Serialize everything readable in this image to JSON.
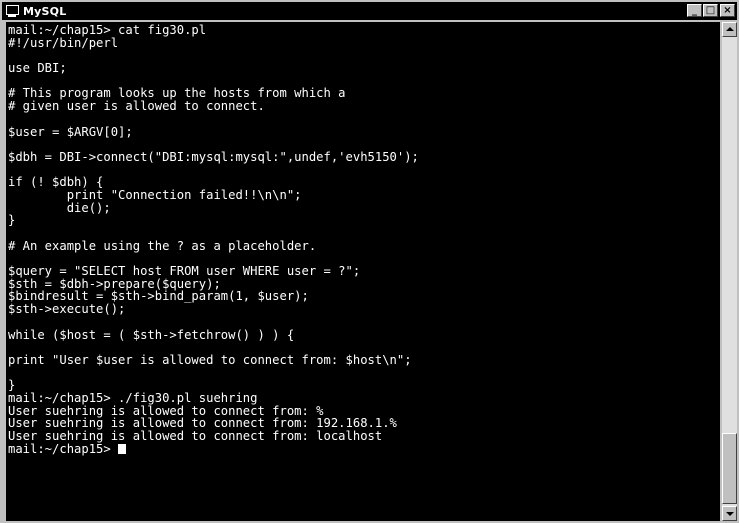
{
  "window": {
    "title": "MySQL",
    "icon": "console-icon",
    "controls": {
      "minimize": "_",
      "maximize": "□",
      "close": "×"
    }
  },
  "console": {
    "lines": [
      "mail:~/chap15> cat fig30.pl",
      "#!/usr/bin/perl",
      "",
      "use DBI;",
      "",
      "# This program looks up the hosts from which a",
      "# given user is allowed to connect.",
      "",
      "$user = $ARGV[0];",
      "",
      "$dbh = DBI->connect(\"DBI:mysql:mysql:\",undef,'evh5150');",
      "",
      "if (! $dbh) {",
      "        print \"Connection failed!!\\n\\n\";",
      "        die();",
      "}",
      "",
      "# An example using the ? as a placeholder.",
      "",
      "$query = \"SELECT host FROM user WHERE user = ?\";",
      "$sth = $dbh->prepare($query);",
      "$bindresult = $sth->bind_param(1, $user);",
      "$sth->execute();",
      "",
      "while ($host = ( $sth->fetchrow() ) ) {",
      "",
      "print \"User $user is allowed to connect from: $host\\n\";",
      "",
      "}",
      "mail:~/chap15> ./fig30.pl suehring",
      "User suehring is allowed to connect from: %",
      "User suehring is allowed to connect from: 192.168.1.%",
      "User suehring is allowed to connect from: localhost"
    ],
    "prompt": "mail:~/chap15> "
  },
  "scrollbar": {
    "up_icon": "arrow-up-icon",
    "down_icon": "arrow-down-icon"
  }
}
